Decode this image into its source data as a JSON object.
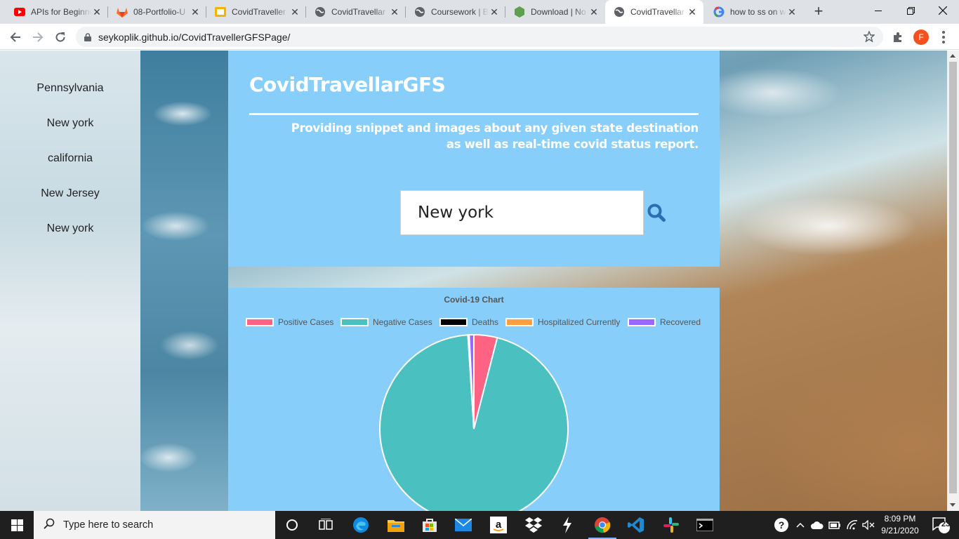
{
  "browser": {
    "tabs": [
      {
        "title": "APIs for Beginners",
        "favicon": "youtube-icon",
        "active": false
      },
      {
        "title": "08-Portfolio-U",
        "favicon": "gitlab-icon",
        "active": false
      },
      {
        "title": "CovidTraveller",
        "favicon": "slides-icon",
        "active": false
      },
      {
        "title": "CovidTravellar",
        "favicon": "globe-icon",
        "active": false
      },
      {
        "title": "Coursework | B",
        "favicon": "globe-icon",
        "active": false
      },
      {
        "title": "Download | No",
        "favicon": "node-icon",
        "active": false
      },
      {
        "title": "CovidTravellar",
        "favicon": "globe-icon",
        "active": true
      },
      {
        "title": "how to ss on w",
        "favicon": "google-icon",
        "active": false
      }
    ],
    "new_tab_label": "+",
    "url": "seykoplik.github.io/CovidTravellerGFSPage/",
    "profile_initial": "F"
  },
  "page": {
    "sidebar": {
      "items": [
        "Pennsylvania",
        "New york",
        "california",
        "New Jersey",
        "New york"
      ]
    },
    "header": {
      "title": "CovidTravellarGFS",
      "tagline_line1": "Providing snippet and images about any given state destination",
      "tagline_line2": "as well as real-time covid status report."
    },
    "search": {
      "value": "New york"
    },
    "chart": {
      "title": "Covid-19 Chart",
      "legend": [
        {
          "label": "Positive Cases",
          "color": "#ff6384"
        },
        {
          "label": "Negative Cases",
          "color": "#4bc0c0"
        },
        {
          "label": "Deaths",
          "color": "#000000"
        },
        {
          "label": "Hospitalized Currently",
          "color": "#ff9f40"
        },
        {
          "label": "Recovered",
          "color": "#9966ff"
        }
      ]
    }
  },
  "chart_data": {
    "type": "pie",
    "title": "Covid-19 Chart",
    "categories": [
      "Positive Cases",
      "Negative Cases",
      "Deaths",
      "Hospitalized Currently",
      "Recovered"
    ],
    "values": [
      4.0,
      95.0,
      0.2,
      0.01,
      0.8
    ],
    "colors": [
      "#ff6384",
      "#4bc0c0",
      "#000000",
      "#ff9f40",
      "#9966ff"
    ],
    "legend_position": "top"
  },
  "taskbar": {
    "search_placeholder": "Type here to search",
    "time": "8:09 PM",
    "date": "9/21/2020",
    "notification_count": "23",
    "apps": [
      "cortana-icon",
      "task-view-icon",
      "edge-icon",
      "file-explorer-icon",
      "store-icon",
      "mail-icon",
      "amazon-icon",
      "dropbox-icon",
      "git-bash-icon",
      "chrome-icon",
      "vscode-icon",
      "slack-icon",
      "terminal-icon"
    ]
  }
}
